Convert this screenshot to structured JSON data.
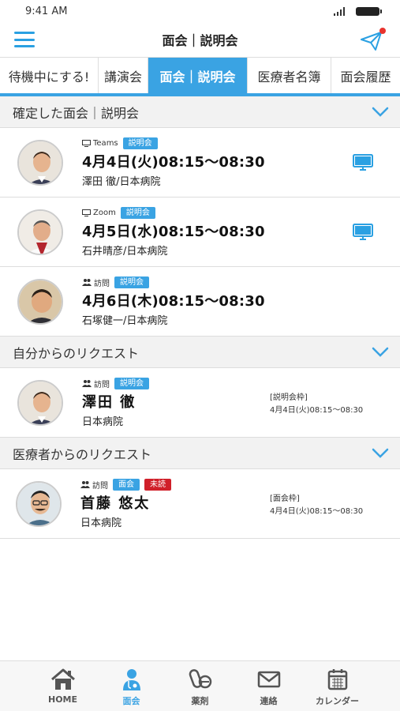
{
  "status_bar": {
    "time": "9:41 AM"
  },
  "header": {
    "title": "面会｜説明会"
  },
  "tabs": [
    {
      "label": "待機中にする!",
      "active": false
    },
    {
      "label": "講演会",
      "active": false
    },
    {
      "label": "面会｜説明会",
      "active": true
    },
    {
      "label": "医療者名簿",
      "active": false
    },
    {
      "label": "面会履歴",
      "active": false
    }
  ],
  "sections": {
    "confirmed": {
      "title": "確定した面会｜説明会",
      "items": [
        {
          "method_icon": "monitor-icon",
          "method": "Teams",
          "tag": "説明会",
          "datetime": "4月4日(火)08:15〜08:30",
          "person": "澤田 徹/日本病院"
        },
        {
          "method_icon": "monitor-icon",
          "method": "Zoom",
          "tag": "説明会",
          "datetime": "4月5日(水)08:15〜08:30",
          "person": "石井晴彦/日本病院"
        },
        {
          "method_icon": "people-icon",
          "method": "訪問",
          "tag": "説明会",
          "datetime": "4月6日(木)08:15〜08:30",
          "person": "石塚健一/日本病院"
        }
      ]
    },
    "my_requests": {
      "title": "自分からのリクエスト",
      "items": [
        {
          "method": "訪問",
          "tag": "説明会",
          "name": "澤田 徹",
          "hospital": "日本病院",
          "slot_label": "[説明会枠]",
          "slot_time": "4月4日(火)08:15〜08:30"
        }
      ]
    },
    "medical_requests": {
      "title": "医療者からのリクエスト",
      "items": [
        {
          "method": "訪問",
          "tag": "面会",
          "tag2": "未読",
          "name": "首藤 悠太",
          "hospital": "日本病院",
          "slot_label": "[面会枠]",
          "slot_time": "4月4日(火)08:15〜08:30"
        }
      ]
    }
  },
  "bottom_nav": [
    {
      "label": "HOME",
      "icon": "home-icon",
      "active": false
    },
    {
      "label": "面会",
      "icon": "doctor-icon",
      "active": true
    },
    {
      "label": "薬剤",
      "icon": "pills-icon",
      "active": false
    },
    {
      "label": "連絡",
      "icon": "mail-icon",
      "active": false
    },
    {
      "label": "カレンダー",
      "icon": "calendar-icon",
      "active": false
    }
  ],
  "colors": {
    "accent": "#3aa3e3",
    "unread": "#d0202a",
    "notification": "#e8332e"
  }
}
